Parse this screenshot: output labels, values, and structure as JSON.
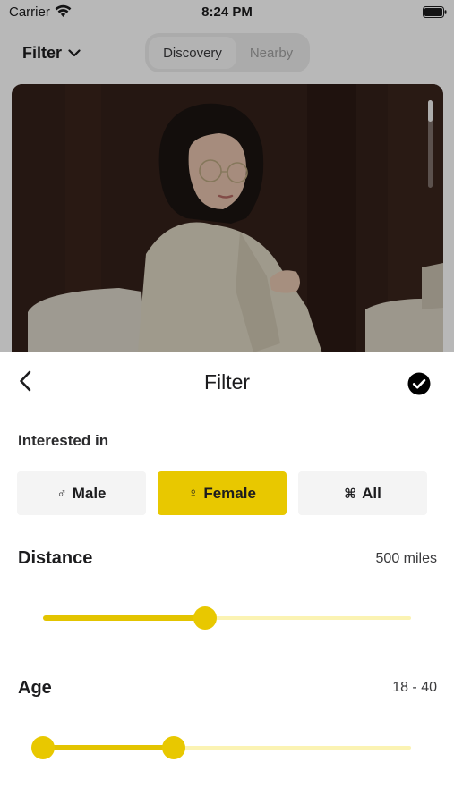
{
  "status_bar": {
    "carrier": "Carrier",
    "time": "8:24 PM"
  },
  "header": {
    "filter_label": "Filter",
    "tabs": [
      {
        "label": "Discovery",
        "active": true
      },
      {
        "label": "Nearby",
        "active": false
      }
    ]
  },
  "sheet": {
    "title": "Filter",
    "interested_label": "Interested in",
    "gender_options": [
      {
        "icon": "♂",
        "label": "Male",
        "selected": false
      },
      {
        "icon": "♀",
        "label": "Female",
        "selected": true
      },
      {
        "icon": "⌘",
        "label": "All",
        "selected": false
      }
    ],
    "distance": {
      "label": "Distance",
      "value_text": "500 miles",
      "slider_fraction": 0.44
    },
    "age": {
      "label": "Age",
      "value_text": "18 - 40",
      "range_fraction": [
        0.0,
        0.355
      ]
    }
  },
  "colors": {
    "accent": "#e8c800",
    "track_light": "#fbf3b3",
    "sheet_bg": "#ffffff"
  },
  "icons": {
    "back": "chevron-left-icon",
    "confirm": "checkmark-circle-icon",
    "wifi": "wifi-icon",
    "battery": "battery-icon",
    "dropdown": "chevron-down-icon"
  }
}
